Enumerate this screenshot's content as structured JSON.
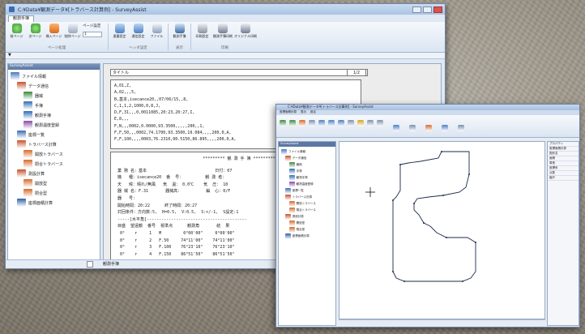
{
  "window1": {
    "title": "C:¥Data¥観測データ¥[トラバース計算例] - SurveyAssist",
    "tab": "観測手簿",
    "ribbon": {
      "buttons": [
        "前ページ",
        "次ページ",
        "挿入ページ",
        "削除ページ",
        "ページ設定",
        "連番設定",
        "通信設定",
        "ファイル",
        "観測手簿",
        "印刷設定",
        "観測手簿印刷",
        "オリジナル印刷"
      ],
      "dropdown": "1",
      "groups": [
        "ページ処理",
        "ヘッダ設定",
        "表示",
        "印刷"
      ]
    },
    "context_label": "▼",
    "sidebar": {
      "header": "SurveyAssist",
      "items": [
        "ファイル情報",
        "データ通信",
        "器械",
        "手簿",
        "観測手簿",
        "観測温度登録",
        "座標一覧",
        "トラバース計算",
        "開放トラバース",
        "閉合トラバース",
        "測設計算",
        "開放型",
        "閉合型",
        "座標面積計算"
      ]
    },
    "doc": {
      "title_label": "タイトル",
      "page": "1/2",
      "raw_lines": [
        "A,01,Z,",
        "A,02,,,5,",
        "B,基本,isecance20,,07/06/15,,8,",
        "C,1,1,2,1000,0,8,J,",
        "D,F,31,,,0,0011085,20:23,20:27,I,",
        "E,8,,,",
        "F,N,,,0002,0.0000,93.3500,,,,,200,,1,",
        "F,F,50,,,0002,74.1700,93.3500,10.084,,,,200,0,A,",
        "F,F,100,,,,0003,76.2310,00.5150,86.895,,,,200,0,A,"
      ],
      "report_title": "********* 観 測 手 簿 *********",
      "rows": [
        "業 務 名：基本                            日付：07",
        "機   種：isecance20  番  号：         観 測 者：",
        "天   候：晴れ/無風   気  温： 0.0℃    気  圧： 10",
        "器 械 名：F.31       器械高：          編  心：0/F",
        "器   号：",
        "開始時間：20:22      終了時間：20:27",
        "対回条件：方向数:5,  H=0.5,  V:0.5,  S:+/-1,  S設定:1",
        "-----[水平角]-----------------------------------------",
        "目盛  望遠鏡  番号  視準点      観測角       結  果",
        " 0°    r     1   M         0°00'00\"     0°00'00\"",
        " 0°    r     2   F.50     74°11'00\"    74°11'00\"",
        " 0°    r     3   F.100    76°23'10\"    76°23'10\"",
        " 0°    r     4   F.150    86°51'50\"    86°51'50\""
      ]
    },
    "status_text": "観測手簿"
  },
  "window2": {
    "title": "C:¥Data¥観測データ¥[トラバース計算例] - SurveyAssist",
    "tabs": [
      "座標面積計算",
      "表示",
      "設定"
    ],
    "sidebar_header": "SurveyAssist",
    "sidebar_items": [
      "ファイル情報",
      "データ通信",
      "器械",
      "手簿",
      "観測手簿",
      "観測温度登録",
      "座標一覧",
      "トラバース計算",
      "開放トラバース",
      "閉合トラバース",
      "測設計算",
      "開放型",
      "閉合型",
      "座標面積計算"
    ],
    "props": [
      "プロパティ",
      "座標面積計算",
      "図形名",
      "面積",
      "周長",
      "座標系",
      "点数",
      "縮尺"
    ]
  },
  "colors": {
    "ribbon_blue": "#dbe6f3",
    "title_blue": "#a9c3e3"
  }
}
